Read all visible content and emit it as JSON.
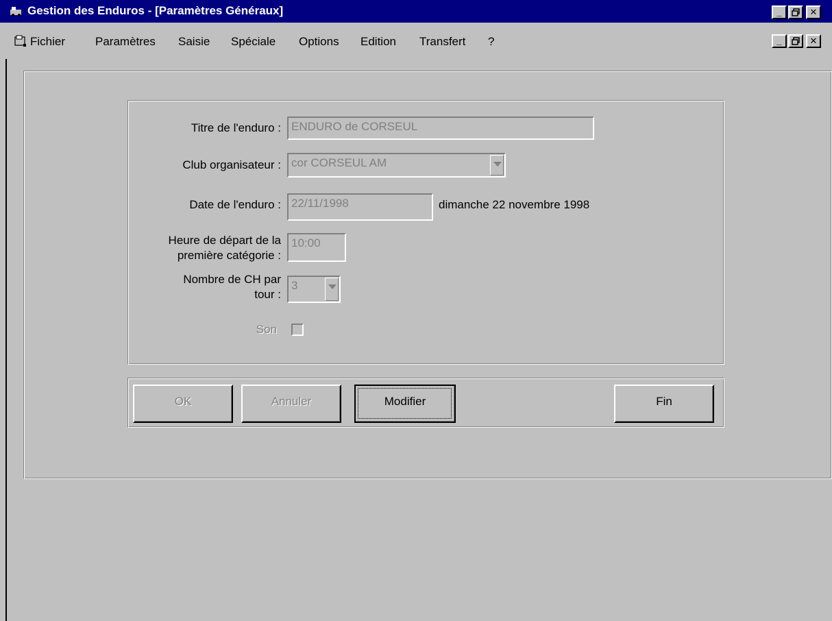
{
  "window": {
    "title": "Gestion des Enduros - [Paramètres Généraux]",
    "controls": {
      "minimize": "_",
      "restore": "▫",
      "close": "✕"
    }
  },
  "menu": {
    "items": [
      "Fichier",
      "Paramètres",
      "Saisie",
      "Spéciale",
      "Options",
      "Edition",
      "Transfert",
      "?"
    ]
  },
  "form": {
    "titre": {
      "label": "Titre de l'enduro :",
      "value": "ENDURO de CORSEUL"
    },
    "club": {
      "label": "Club organisateur :",
      "value": "cor  CORSEUL AM"
    },
    "date": {
      "label": "Date de l'enduro :",
      "value": "22/11/1998",
      "long_date": "dimanche 22 novembre 1998"
    },
    "heure": {
      "label_line1": "Heure de départ de la",
      "label_line2": "première catégorie :",
      "value": "10:00"
    },
    "nombre_ch": {
      "label_line1": "Nombre de CH par",
      "label_line2": "tour :",
      "value": "3"
    },
    "son": {
      "label": "Son",
      "checked": false
    }
  },
  "buttons": {
    "ok": "OK",
    "annuler": "Annuler",
    "modifier": "Modifier",
    "fin": "Fin"
  },
  "colors": {
    "titlebar": "#000080",
    "face": "#c0c0c0",
    "disabled_text": "#808080"
  }
}
